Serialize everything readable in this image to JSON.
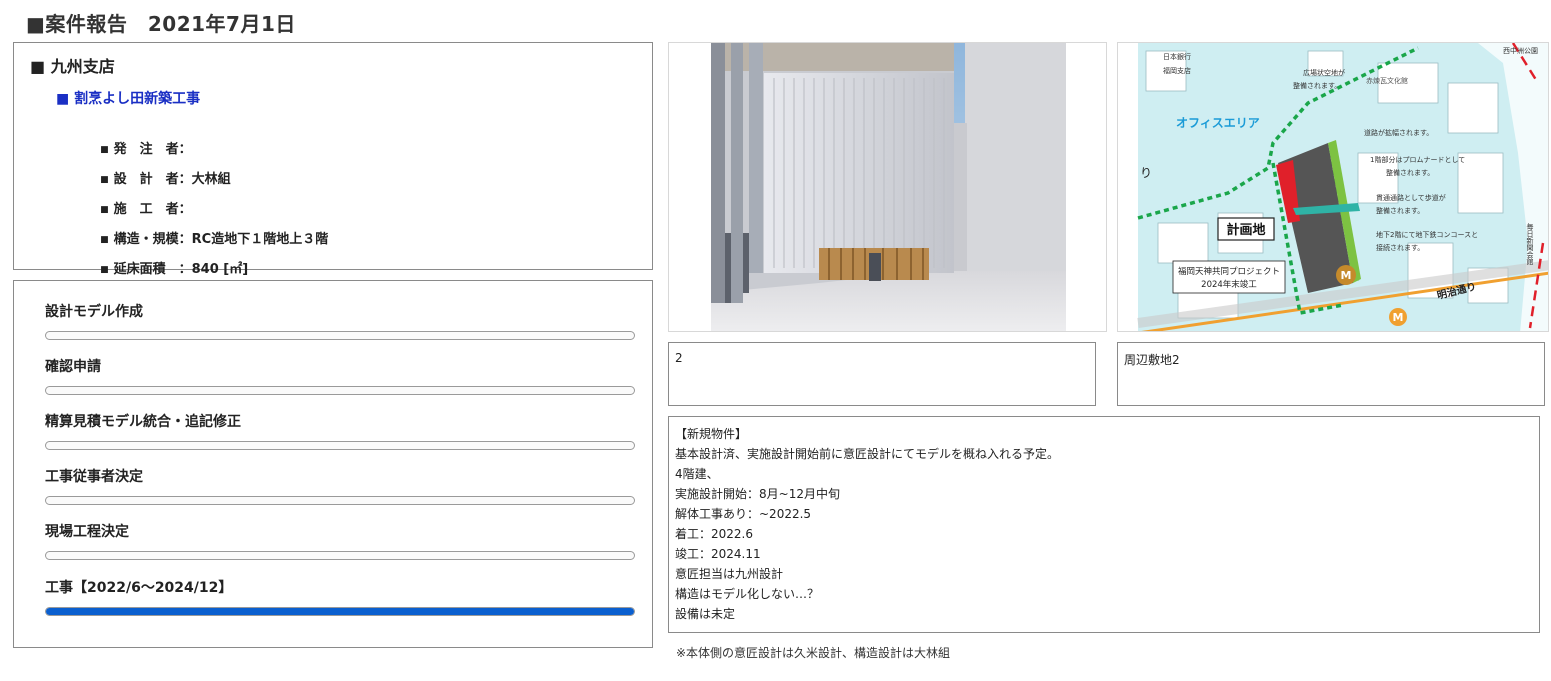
{
  "report": {
    "title": "■案件報告　2021年7月1日"
  },
  "info": {
    "branch": "■ 九州支店",
    "project": "■ 割烹よし田新築工事",
    "details": [
      {
        "label": "発　注　者：",
        "value": ""
      },
      {
        "label": "設　計　者：",
        "value": "大林組"
      },
      {
        "label": "施　工　者：",
        "value": ""
      },
      {
        "label": "構造・規模：",
        "value": "RC造地下１階地上３階"
      },
      {
        "label": "延床面積　：",
        "value": "840 [㎡]"
      }
    ]
  },
  "progress": {
    "steps": [
      {
        "label": "設計モデル作成",
        "progress": 0
      },
      {
        "label": "確認申請",
        "progress": 0
      },
      {
        "label": "精算見積モデル統合・追記修正",
        "progress": 0
      },
      {
        "label": "工事従事者決定",
        "progress": 0
      },
      {
        "label": "現場工程決定",
        "progress": 0
      },
      {
        "label": "工事【2022/6～2024/12】",
        "progress": 1.0
      }
    ],
    "bar_color": "#0a5fcf"
  },
  "images": {
    "map_labels": {
      "bank": "日本銀行",
      "bank_branch": "福岡支店",
      "park": "西中洲公園",
      "plaza": "広場状空地が",
      "plaza2": "整備されます。",
      "culture": "赤煉瓦文化館",
      "office_area": "オフィスエリア",
      "road_widen": "道路が拡幅されます。",
      "promenade1": "1階部分はプロムナードとして",
      "promenade2": "整備されます。",
      "walkway1": "貫通通路として歩道が",
      "walkway2": "整備されます。",
      "site": "計画地",
      "subway1": "地下2階にて地下鉄コンコースと",
      "subway2": "接続されます。",
      "joint1": "福岡天神共同プロジェクト",
      "joint2": "2024年末竣工",
      "meiji": "明治通り",
      "metro": "M",
      "dori": "り",
      "newspaper": "毎日新聞会館"
    }
  },
  "captions": {
    "first": "2",
    "second": "周辺敷地2"
  },
  "notes": [
    "【新規物件】",
    "基本設計済、実施設計開始前に意匠設計にてモデルを概ね入れる予定。",
    "4階建、",
    "実施設計開始：8月~12月中旬",
    "解体工事あり：~2022.5",
    "着工：2022.6",
    "竣工：2024.11",
    "意匠担当は九州設計",
    "構造はモデル化しない…？",
    "設備は未定"
  ],
  "footnote": "※本体側の意匠設計は久米設計、構造設計は大林組",
  "colors": {
    "project_link": "#1a2fc4",
    "map_green": "#1aa64a",
    "map_route": "#f0a030",
    "map_red": "#e0202a",
    "map_water": "#cfeef2"
  }
}
